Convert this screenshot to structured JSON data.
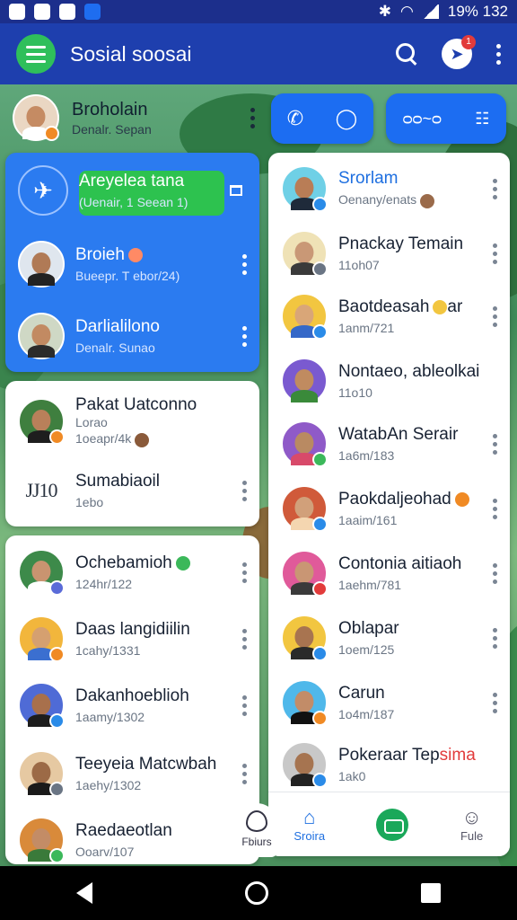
{
  "status_bar": {
    "battery_time": "19%  132"
  },
  "app_bar": {
    "title": "Sosial soosai",
    "notification_count": "1"
  },
  "top_profile": {
    "name": "Broholain",
    "subtitle": "Denalr. Sepan"
  },
  "pill_group_right": {
    "label": "ᴑᴑ~ᴑ"
  },
  "left_blue_card": {
    "items": [
      {
        "name": "Areyelea tana",
        "sub": "(Uenair, 1 Seean 1)"
      },
      {
        "name": "Broieh",
        "sub": "Bueepr. T ebor/24)"
      },
      {
        "name": "Darlialilono",
        "sub": "Denalr. Sunao"
      }
    ]
  },
  "left_card_a": {
    "items": [
      {
        "name": "Pakat Uatconno",
        "sub": "Lorao",
        "sub2": "1oeapr/4k"
      },
      {
        "monogram": "JJ10",
        "name": "Sumabiaoil",
        "sub": "1ebo"
      }
    ]
  },
  "left_card_b": {
    "items": [
      {
        "name": "Ochebamioh",
        "sub": "124hr/122"
      },
      {
        "name": "Daas langidiilin",
        "sub": "1cahy/1331"
      },
      {
        "name": "Dakanhoeblioh",
        "sub": "1aamy/1302"
      },
      {
        "name": "Teeyeia Matcwbah",
        "sub": "1aehy/1302"
      },
      {
        "name": "Raedaeotlan",
        "sub": "Ooarv/107"
      }
    ]
  },
  "right_card": {
    "items": [
      {
        "name": "Srorlam",
        "sub": "Oenany/enats"
      },
      {
        "name": "Pnackay Temain",
        "sub": "11oh07"
      },
      {
        "name": "Baotdeasah",
        "name_suffix": "ar",
        "sub": "1anm/721"
      },
      {
        "name": "Nontaeo, ableolkai",
        "sub": "11o10"
      },
      {
        "name": "WatabAn Serair",
        "sub": "1a6m/183"
      },
      {
        "name": "Paokdaljeohad",
        "sub": "1aaim/161"
      },
      {
        "name": "Contonia aitiaoh",
        "sub": "1aehm/781"
      },
      {
        "name": "Oblapar",
        "sub": "1oem/125"
      },
      {
        "name": "Carun",
        "sub": "1o4m/187"
      },
      {
        "name": "Pokeraar Tep",
        "name_red": "sima",
        "sub": "1ak0"
      }
    ]
  },
  "bottom_nav": {
    "fav_label": "Fbiurs",
    "items": [
      {
        "label": "Sroira"
      },
      {
        "label": ""
      },
      {
        "label": "Fule"
      }
    ]
  },
  "colors": {
    "app_bar": "#1e3fae",
    "accent_blue": "#2b7bf0",
    "accent_green": "#2dc24f"
  }
}
